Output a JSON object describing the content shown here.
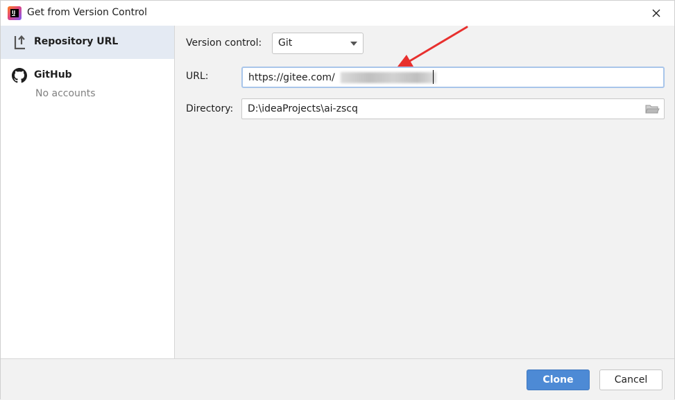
{
  "window": {
    "title": "Get from Version Control"
  },
  "sidebar": {
    "items": [
      {
        "label": "Repository URL",
        "icon": "repository-icon",
        "selected": true
      },
      {
        "label": "GitHub",
        "sublabel": "No accounts",
        "icon": "github-icon",
        "selected": false
      }
    ]
  },
  "form": {
    "version_control": {
      "label": "Version control:",
      "value": "Git"
    },
    "url": {
      "label": "URL:",
      "value": "https://gitee.com/"
    },
    "directory": {
      "label": "Directory:",
      "value": "D:\\ideaProjects\\ai-zscq",
      "icon": "folder-icon"
    }
  },
  "footer": {
    "clone_label": "Clone",
    "cancel_label": "Cancel"
  },
  "colors": {
    "accent": "#4d8ad5",
    "selection": "#e4eaf3",
    "annotation": "#e8302e"
  }
}
